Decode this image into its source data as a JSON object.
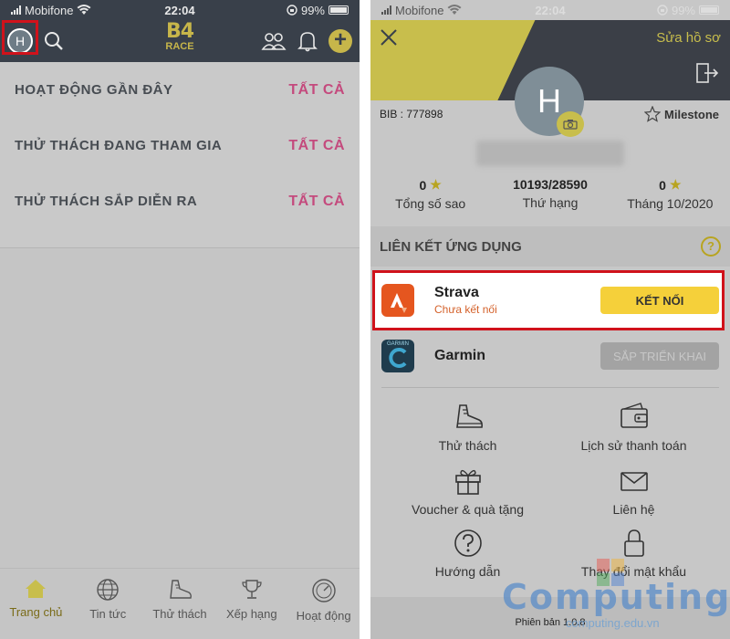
{
  "left": {
    "status": {
      "carrier": "Mobifone",
      "time": "22:04",
      "battery": "99%"
    },
    "avatar_letter": "H",
    "logo": {
      "big": "B4",
      "small": "RACE"
    },
    "rows": [
      {
        "label": "HOẠT ĐỘNG GẦN ĐÂY",
        "action": "TẤT CẢ"
      },
      {
        "label": "THỬ THÁCH ĐANG THAM GIA",
        "action": "TẤT CẢ"
      },
      {
        "label": "THỬ THÁCH SẮP DIỄN RA",
        "action": "TẤT CẢ"
      }
    ],
    "tabs": [
      {
        "label": "Trang chủ",
        "icon": "home-icon"
      },
      {
        "label": "Tin tức",
        "icon": "globe-icon"
      },
      {
        "label": "Thử thách",
        "icon": "shoe-icon"
      },
      {
        "label": "Xếp hạng",
        "icon": "trophy-icon"
      },
      {
        "label": "Hoạt động",
        "icon": "gauge-icon"
      }
    ]
  },
  "right": {
    "status": {
      "carrier": "Mobifone",
      "time": "22:04",
      "battery": "99%"
    },
    "edit_label": "Sửa hồ sơ",
    "avatar_letter": "H",
    "bib": "BIB : 777898",
    "milestone": "Milestone",
    "stats": [
      {
        "value": "0",
        "label": "Tổng số sao",
        "star": true
      },
      {
        "value": "10193/28590",
        "label": "Thứ hạng",
        "star": false
      },
      {
        "value": "0",
        "label": "Tháng 10/2020",
        "star": true
      }
    ],
    "link_title": "LIÊN KẾT ỨNG DỤNG",
    "help": "?",
    "apps": [
      {
        "name": "Strava",
        "status": "Chưa kết nối",
        "button": "KẾT NỐI"
      },
      {
        "name": "Garmin",
        "status": "",
        "button": "SẮP TRIỂN KHAI",
        "brand_text": "GARMIN"
      }
    ],
    "menu": [
      {
        "label": "Thử thách",
        "icon": "shoe-icon"
      },
      {
        "label": "Lịch sử thanh toán",
        "icon": "wallet-icon"
      },
      {
        "label": "Voucher & quà tặng",
        "icon": "gift-icon"
      },
      {
        "label": "Liên hệ",
        "icon": "mail-icon"
      },
      {
        "label": "Hướng dẫn",
        "icon": "help-icon"
      },
      {
        "label": "Thay đổi mật khẩu",
        "icon": "lock-icon"
      }
    ],
    "version": "Phiên bản 1.0.8"
  },
  "watermark": {
    "text": "Computing",
    "sub": "computing.edu.vn"
  },
  "colors": {
    "accent_yellow": "#c8be4c",
    "dark_header": "#39404a",
    "highlight_red": "#d0121b",
    "strava_orange": "#e5561f",
    "pink_link": "#c44a7d"
  }
}
